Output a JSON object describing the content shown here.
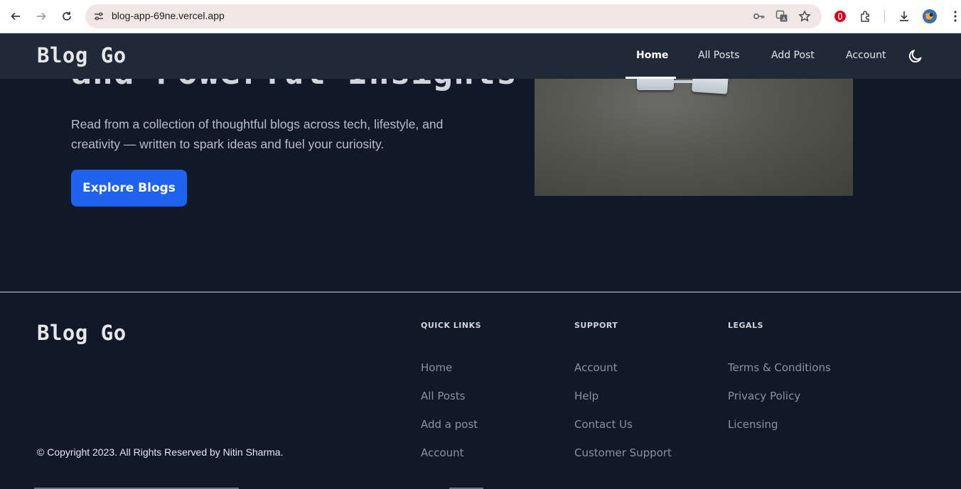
{
  "browser": {
    "url": "blog-app-69ne.vercel.app",
    "icons": [
      "back-icon",
      "forward-icon",
      "reload-icon",
      "site-settings-icon",
      "password-key-icon",
      "translate-icon",
      "bookmark-star-icon",
      "opera-extension-icon",
      "extensions-puzzle-icon",
      "download-icon",
      "profile-avatar"
    ]
  },
  "header": {
    "brand": "Blog Go",
    "nav": [
      {
        "label": "Home",
        "active": true
      },
      {
        "label": "All Posts",
        "active": false
      },
      {
        "label": "Add Post",
        "active": false
      },
      {
        "label": "Account",
        "active": false
      }
    ],
    "theme_toggle_icon": "moon-icon"
  },
  "hero": {
    "title_visible": "and Powerful Insights",
    "description": "Read from a collection of thoughtful blogs across tech, lifestyle, and creativity — written to spark ideas and fuel your curiosity.",
    "cta_label": "Explore Blogs"
  },
  "footer": {
    "brand": "Blog Go",
    "copyright": "© Copyright 2023. All Rights Reserved by Nitin Sharma.",
    "columns": [
      {
        "heading": "QUICK LINKS",
        "links": [
          "Home",
          "All Posts",
          "Add a post",
          "Account"
        ]
      },
      {
        "heading": "SUPPORT",
        "links": [
          "Account",
          "Help",
          "Contact Us",
          "Customer Support"
        ]
      },
      {
        "heading": "LEGALS",
        "links": [
          "Terms & Conditions",
          "Privacy Policy",
          "Licensing"
        ]
      }
    ]
  },
  "colors": {
    "page_bg": "#111827",
    "header_bg": "#1f2937",
    "cta_bg": "#1d63ed",
    "link_muted": "#8a929e"
  }
}
